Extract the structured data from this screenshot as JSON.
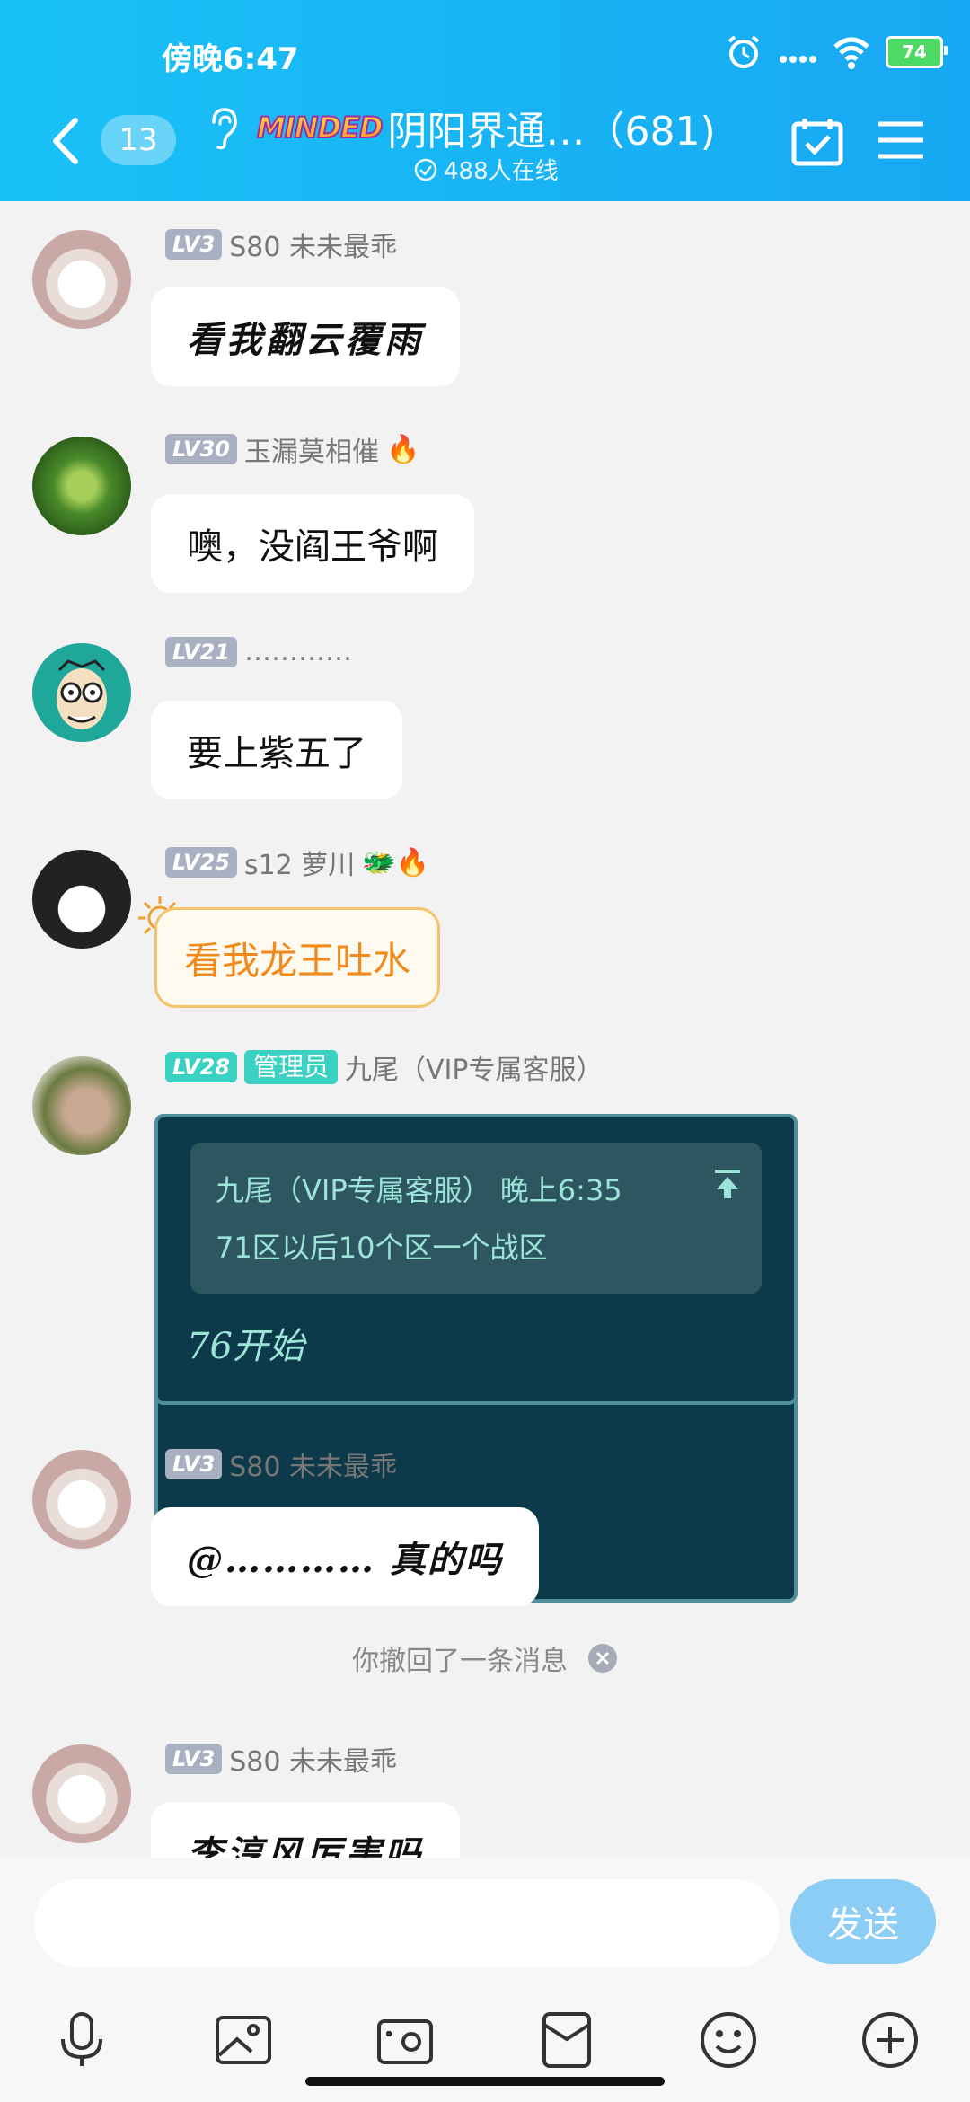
{
  "status": {
    "time": "傍晚6:47",
    "battery": "74"
  },
  "header": {
    "unread": "13",
    "logo_text": "MINDED",
    "title": "阴阳界通…（681)",
    "online": "488人在线"
  },
  "messages": [
    {
      "level": "LV3",
      "name": "S80 未未最乖",
      "text": "看我翻云覆雨"
    },
    {
      "level": "LV30",
      "name": "玉漏莫相催",
      "badge": "🔥",
      "text": "噢，没阎王爷啊"
    },
    {
      "level": "LV21",
      "name": "…………",
      "text": "要上紫五了"
    },
    {
      "level": "LV25",
      "name": "s12 萝川",
      "badge": "🐲🔥",
      "text": "看我龙王吐水"
    },
    {
      "level": "LV28",
      "role": "管理员",
      "name": "九尾（VIP专属客服）",
      "quote_header": "九尾（VIP专属客服） 晚上6:35",
      "quote_text": "71区以后10个区一个战区",
      "text": "76开始"
    },
    {
      "level": "LV3",
      "name": "S80 未未最乖",
      "text": "@…………  真的吗"
    },
    {
      "level": "LV3",
      "name": "S80 未未最乖",
      "text": "李淳风厉害吗"
    }
  ],
  "recall_notice": "你撤回了一条消息",
  "input": {
    "send_label": "发送"
  }
}
